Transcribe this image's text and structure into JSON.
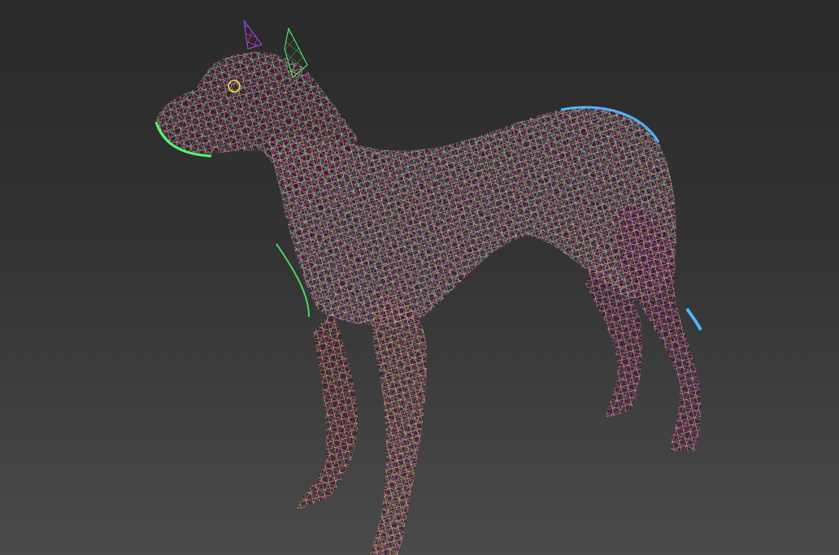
{
  "viewport": {
    "mode": "wireframe",
    "background_top": "#2a2a2a",
    "background_bottom": "#4a4a4a"
  },
  "model": {
    "subject": "dog",
    "display": "wireframe mesh",
    "wire_colors": [
      "#ff4fd8",
      "#ffe14f",
      "#4fff6a",
      "#4fb6ff",
      "#ff5a5a",
      "#7b5cff",
      "#ffffff",
      "#4ff0ff"
    ],
    "icon": "mesh-icon"
  }
}
